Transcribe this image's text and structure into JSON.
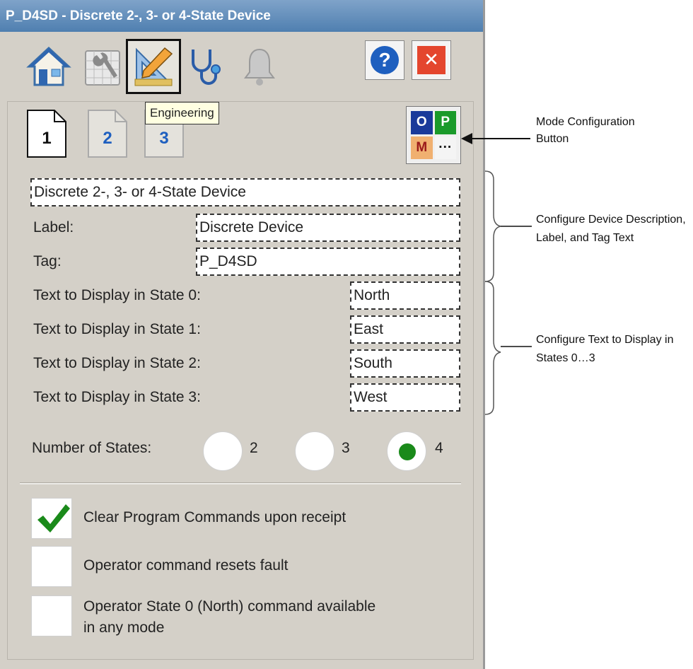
{
  "window": {
    "title": "P_D4SD - Discrete 2-, 3- or 4-State Device"
  },
  "toolbar": {
    "tabs": [
      {
        "name": "home-icon"
      },
      {
        "name": "maintenance-icon"
      },
      {
        "name": "engineering-icon"
      },
      {
        "name": "diagnostics-icon"
      },
      {
        "name": "alarm-bell-icon"
      }
    ],
    "tooltip": "Engineering",
    "help_symbol": "?",
    "close_symbol": "✕"
  },
  "pages": {
    "p1": "1",
    "p2": "2",
    "p3": "3"
  },
  "mode_button": {
    "o": "O",
    "p": "P",
    "m": "M",
    "more": "···"
  },
  "form": {
    "description": "Discrete 2-, 3- or 4-State Device",
    "label_caption": "Label:",
    "label_value": "Discrete Device",
    "tag_caption": "Tag:",
    "tag_value": "P_D4SD",
    "states": [
      {
        "caption": "Text to Display in State 0:",
        "value": "North"
      },
      {
        "caption": "Text to Display in State 1:",
        "value": "East"
      },
      {
        "caption": "Text to Display in State 2:",
        "value": "South"
      },
      {
        "caption": "Text to Display in State 3:",
        "value": "West"
      }
    ],
    "num_states_caption": "Number of States:",
    "num_states_options": [
      "2",
      "3",
      "4"
    ],
    "num_states_selected": "4"
  },
  "options": [
    {
      "label": "Clear Program Commands upon receipt",
      "checked": true
    },
    {
      "label": "Operator command resets fault",
      "checked": false
    },
    {
      "label_line1": "Operator State 0 (North) command available",
      "label_line2": "in any mode",
      "checked": false
    }
  ],
  "annotations": {
    "mode_config_1": "Mode Configuration",
    "mode_config_2": "Button",
    "desc_1": "Configure Device Description,",
    "desc_2": "Label, and Tag Text",
    "states_1": "Configure Text to Display in",
    "states_2": "States 0…3"
  },
  "colors": {
    "title_bg": "#5a86b8",
    "radio_selected": "#1a8a1a",
    "check": "#1a8a1a"
  }
}
